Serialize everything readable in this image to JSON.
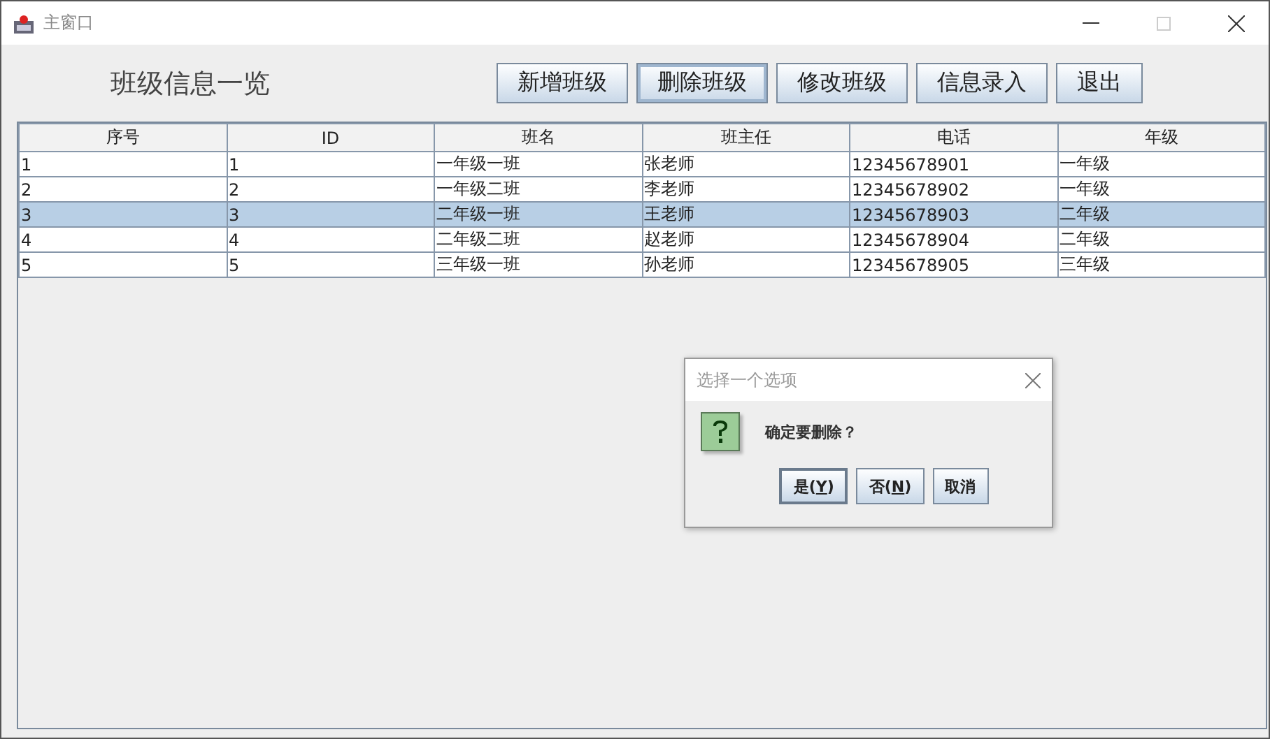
{
  "window": {
    "title": "主窗口"
  },
  "heading": "班级信息一览",
  "toolbar": [
    {
      "label": "新增班级",
      "focused": false
    },
    {
      "label": "删除班级",
      "focused": true
    },
    {
      "label": "修改班级",
      "focused": false
    },
    {
      "label": "信息录入",
      "focused": false
    },
    {
      "label": "退出",
      "focused": false
    }
  ],
  "table": {
    "columns": [
      "序号",
      "ID",
      "班名",
      "班主任",
      "电话",
      "年级"
    ],
    "rows": [
      {
        "cells": [
          "1",
          "1",
          "一年级一班",
          "张老师",
          "12345678901",
          "一年级"
        ],
        "selected": false
      },
      {
        "cells": [
          "2",
          "2",
          "一年级二班",
          "李老师",
          "12345678902",
          "一年级"
        ],
        "selected": false
      },
      {
        "cells": [
          "3",
          "3",
          "二年级一班",
          "王老师",
          "12345678903",
          "二年级"
        ],
        "selected": true
      },
      {
        "cells": [
          "4",
          "4",
          "二年级二班",
          "赵老师",
          "12345678904",
          "二年级"
        ],
        "selected": false
      },
      {
        "cells": [
          "5",
          "5",
          "三年级一班",
          "孙老师",
          "12345678905",
          "三年级"
        ],
        "selected": false
      }
    ]
  },
  "dialog": {
    "title": "选择一个选项",
    "message": "确定要删除？",
    "buttons": [
      {
        "before": "是(",
        "key": "Y",
        "after": ")",
        "focused": true
      },
      {
        "before": "否(",
        "key": "N",
        "after": ")",
        "focused": false
      },
      {
        "before": "取消",
        "focused": false
      }
    ]
  }
}
